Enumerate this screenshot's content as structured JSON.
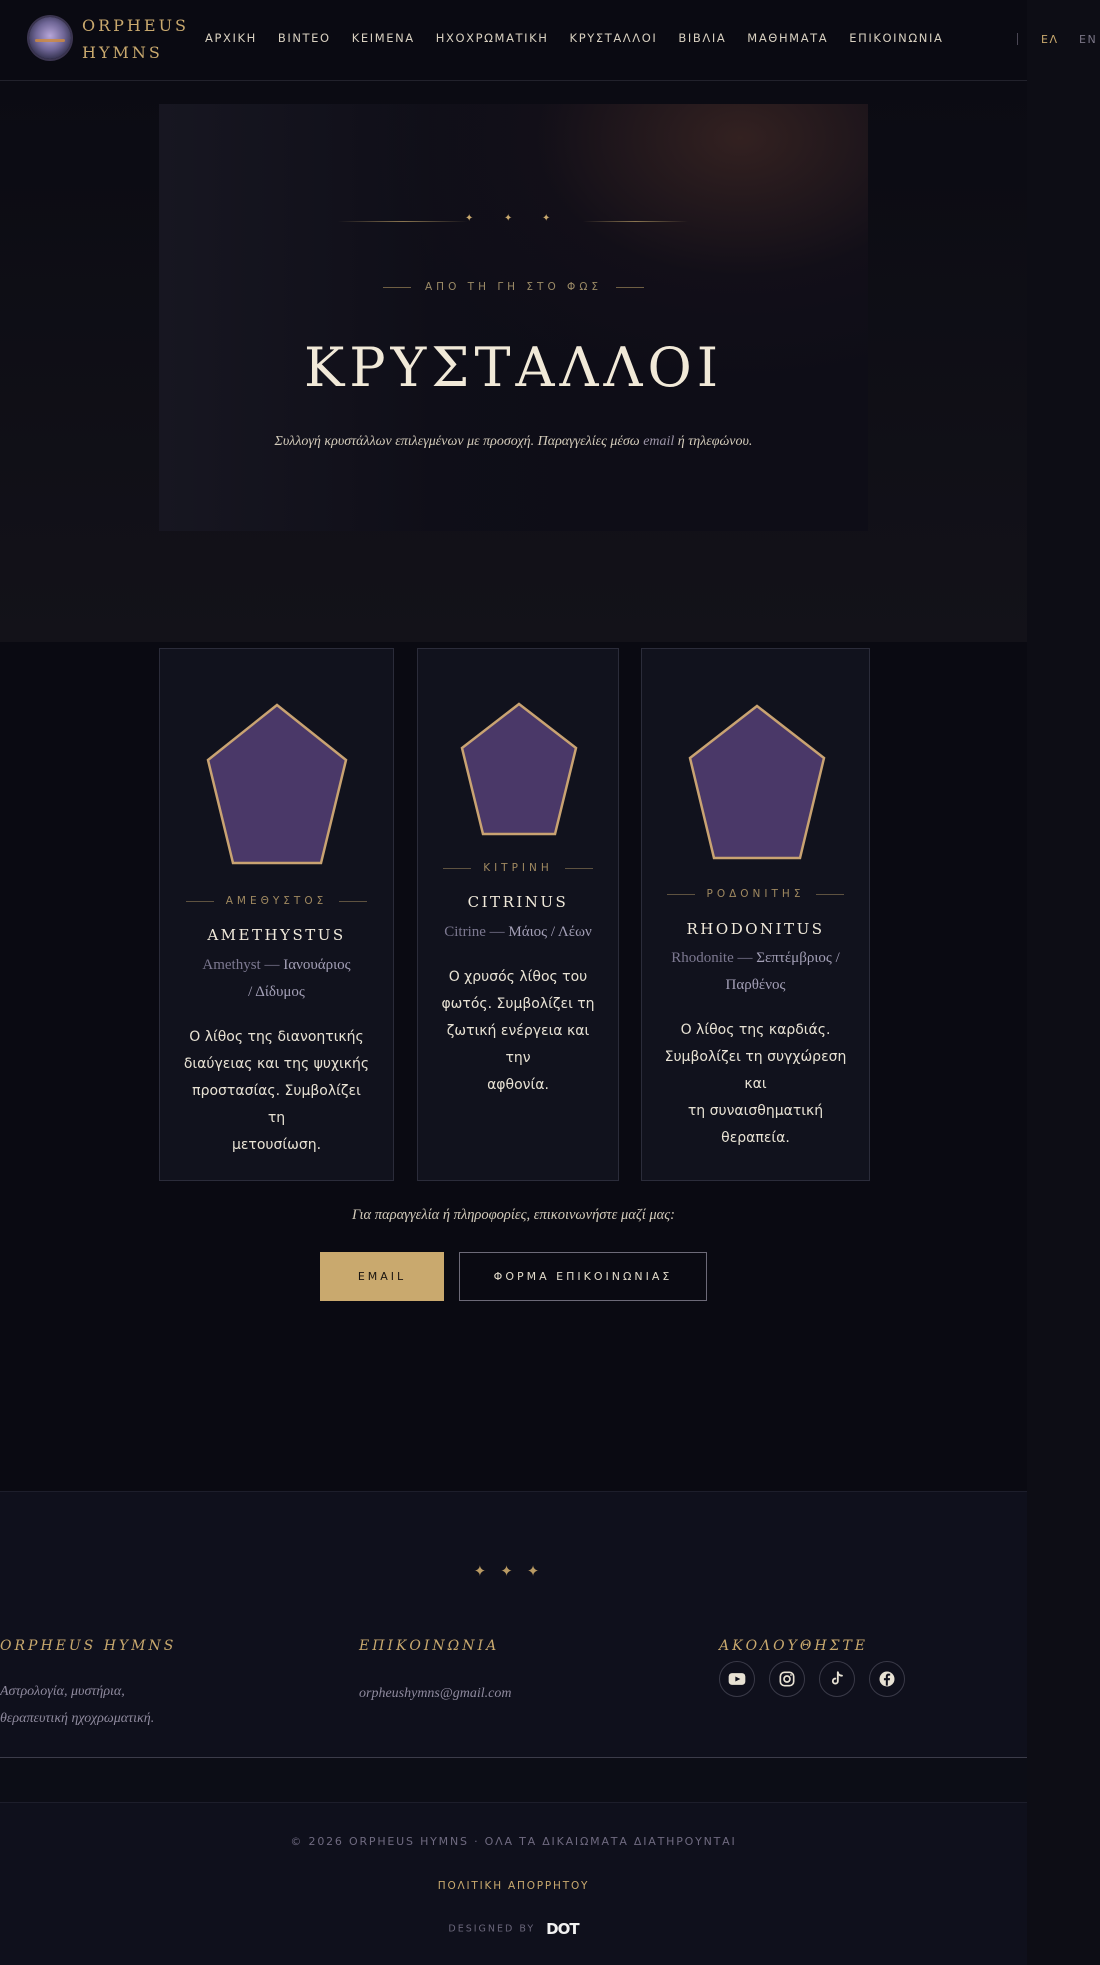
{
  "header": {
    "brand_line1": "ORPHEUS",
    "brand_line2": "HYMNS",
    "nav": [
      "ΑΡΧΙΚΗ",
      "ΒΙΝΤΕΟ",
      "ΚΕΙΜΕΝΑ",
      "ΗΧΟΧΡΩΜΑΤΙΚΗ",
      "ΚΡΥΣΤΑΛΛΟΙ",
      "ΒΙΒΛΙΑ",
      "ΜΑΘΗΜΑΤΑ",
      "ΕΠΙΚΟΙΝΩΝΙΑ"
    ],
    "lang_el": "ΕΛ",
    "lang_en": "EN"
  },
  "hero": {
    "ornament": "✦ ✦ ✦",
    "eyebrow": "ΑΠΟ ΤΗ ΓΗ ΣΤΟ ΦΩΣ",
    "title": "ΚΡΥΣΤΑΛΛΟΙ",
    "subtitle_part1": "Συλλογή κρυστάλλων επιλεγμένων με προσοχή. Παραγγελίες μέσω",
    "subtitle_em": "email",
    "subtitle_part2": "ή τηλεφώνου."
  },
  "crystals": [
    {
      "eyebrow": "ΑΜΕΘΥΣΤΟΣ",
      "name": "AMETHYSTUS",
      "latin": "Amethyst —",
      "signs_line1": "Ιανουάριος",
      "signs_line2": "/ Δίδυμος",
      "desc": [
        "Ο λίθος της διανοητικής",
        "διαύγειας και της ψυχικής",
        "προστασίας. Συμβολίζει τη",
        "μετουσίωση."
      ]
    },
    {
      "eyebrow": "ΚΙΤΡΙΝΗ",
      "name": "CITRINUS",
      "latin": "Citrine —",
      "signs_line1": "Μάιος / Λέων",
      "signs_line2": "",
      "desc": [
        "Ο χρυσός λίθος του",
        "φωτός. Συμβολίζει τη",
        "ζωτική ενέργεια και την",
        "αφθονία."
      ]
    },
    {
      "eyebrow": "ΡΟΔΟΝΙΤΗΣ",
      "name": "RHODONITUS",
      "latin": "Rhodonite —",
      "signs_line1": "Σεπτέμβριος /",
      "signs_line2": "Παρθένος",
      "desc": [
        "Ο λίθος της καρδιάς.",
        "Συμβολίζει τη συγχώρεση και",
        "τη συναισθηματική θεραπεία."
      ]
    }
  ],
  "colors": {
    "crystal_fill": "#4a3868",
    "crystal_stroke": "#c9a372",
    "accent": "#c9a96e"
  },
  "cta": {
    "text": "Για παραγγελία ή πληροφορίες, επικοινωνήστε μαζί μας:",
    "email_button": "EMAIL",
    "form_button": "ΦΟΡΜΑ ΕΠΙΚΟΙΝΩΝΙΑΣ"
  },
  "footer": {
    "stars": "✦✦✦",
    "col1_head": "ORPHEUS HYMNS",
    "col1_line1": "Αστρολογία, μυστήρια,",
    "col1_line2": "θεραπευτική ηχοχρωματική.",
    "col2_head": "ΕΠΙΚΟΙΝΩΝΙΑ",
    "col2_email": "orpheushymns@gmail.com",
    "col3_head": "ΑΚΟΛΟΥΘΗΣΤΕ",
    "social_icons": [
      "youtube-icon",
      "instagram-icon",
      "tiktok-icon",
      "facebook-icon"
    ],
    "copyright": "© 2026 ORPHEUS HYMNS · ΟΛΑ ΤΑ ΔΙΚΑΙΩΜΑΤΑ ΔΙΑΤΗΡΟΥΝΤΑΙ",
    "privacy": "ΠΟΛΙΤΙΚΗ ΑΠΟΡΡΗΤΟΥ",
    "designed_by": "DESIGNED BY",
    "designer_logo": "DOT"
  }
}
